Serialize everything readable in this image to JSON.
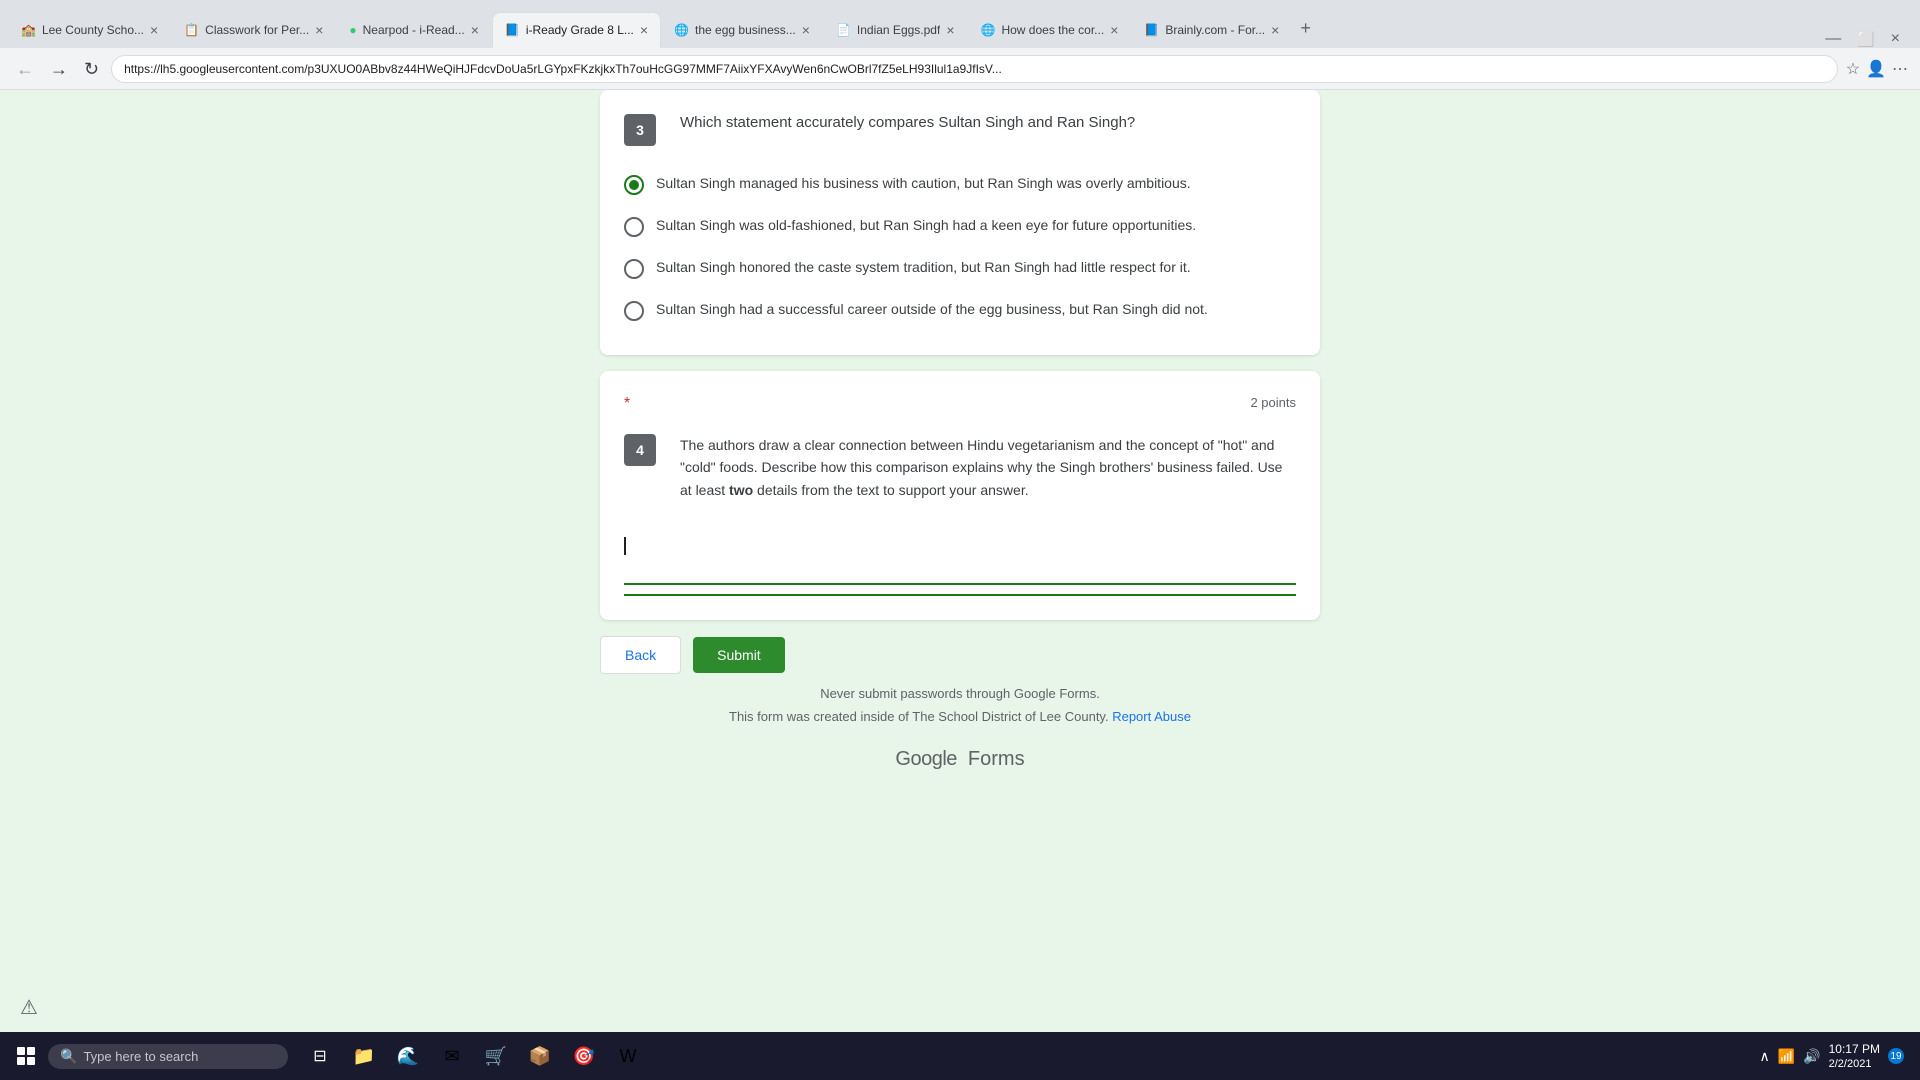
{
  "browser": {
    "url": "https://lh5.googleusercontent.com/p3UXUO0ABbv8z44HWeQiHJFdcvDoUa5rLGYpxFKzkjkxTh7ouHcGG97MMF7AiixYFXAvyWen6nCwOBrl7fZ5eLH93Ilul1a9JfIsV...",
    "tabs": [
      {
        "id": "tab-lee",
        "label": "Lee County Scho...",
        "icon": "🏫",
        "active": false
      },
      {
        "id": "tab-classwork",
        "label": "Classwork for Per...",
        "icon": "📋",
        "active": false
      },
      {
        "id": "tab-nearpod",
        "label": "Nearpod - i-Read...",
        "icon": "🟢",
        "active": false
      },
      {
        "id": "tab-iready",
        "label": "i-Ready Grade 8 L...",
        "icon": "📘",
        "active": true
      },
      {
        "id": "tab-egg",
        "label": "the egg business...",
        "icon": "🌐",
        "active": false
      },
      {
        "id": "tab-indian",
        "label": "Indian Eggs.pdf",
        "icon": "📄",
        "active": false
      },
      {
        "id": "tab-howdoes",
        "label": "How does the cor...",
        "icon": "🌐",
        "active": false
      },
      {
        "id": "tab-brainly",
        "label": "Brainly.com - For...",
        "icon": "📘",
        "active": false
      }
    ]
  },
  "question3": {
    "number": "3",
    "prompt": "Which statement accurately compares Sultan Singh and Ran Singh?",
    "options": [
      {
        "id": "opt1",
        "text": "Sultan Singh managed his business with caution, but Ran Singh was overly ambitious.",
        "selected": true
      },
      {
        "id": "opt2",
        "text": "Sultan Singh was old-fashioned, but Ran Singh had a keen eye for future opportunities.",
        "selected": false
      },
      {
        "id": "opt3",
        "text": "Sultan Singh honored the caste system tradition, but Ran Singh had little respect for it.",
        "selected": false
      },
      {
        "id": "opt4",
        "text": "Sultan Singh had a successful career outside of the egg business, but Ran Singh did not.",
        "selected": false
      }
    ]
  },
  "question4": {
    "number": "4",
    "points": "2 points",
    "prompt": "The authors draw a clear connection between Hindu vegetarianism and the concept of \"hot\" and \"cold\" foods. Describe how this comparison explains why the Singh brothers' business failed. Use at least ",
    "prompt_bold": "two",
    "prompt_end": " details from the text to support your answer.",
    "answer_value": "",
    "answer_placeholder": ""
  },
  "buttons": {
    "back": "Back",
    "submit": "Submit"
  },
  "footer": {
    "never_submit": "Never submit passwords through Google Forms.",
    "form_credit": "This form was created inside of The School District of Lee County.",
    "report_abuse": "Report Abuse",
    "logo_google": "Google",
    "logo_forms": "Forms"
  },
  "taskbar": {
    "search_placeholder": "Type here to search",
    "time": "10:17 PM",
    "date": "2/2/2021",
    "notification_count": "19"
  }
}
